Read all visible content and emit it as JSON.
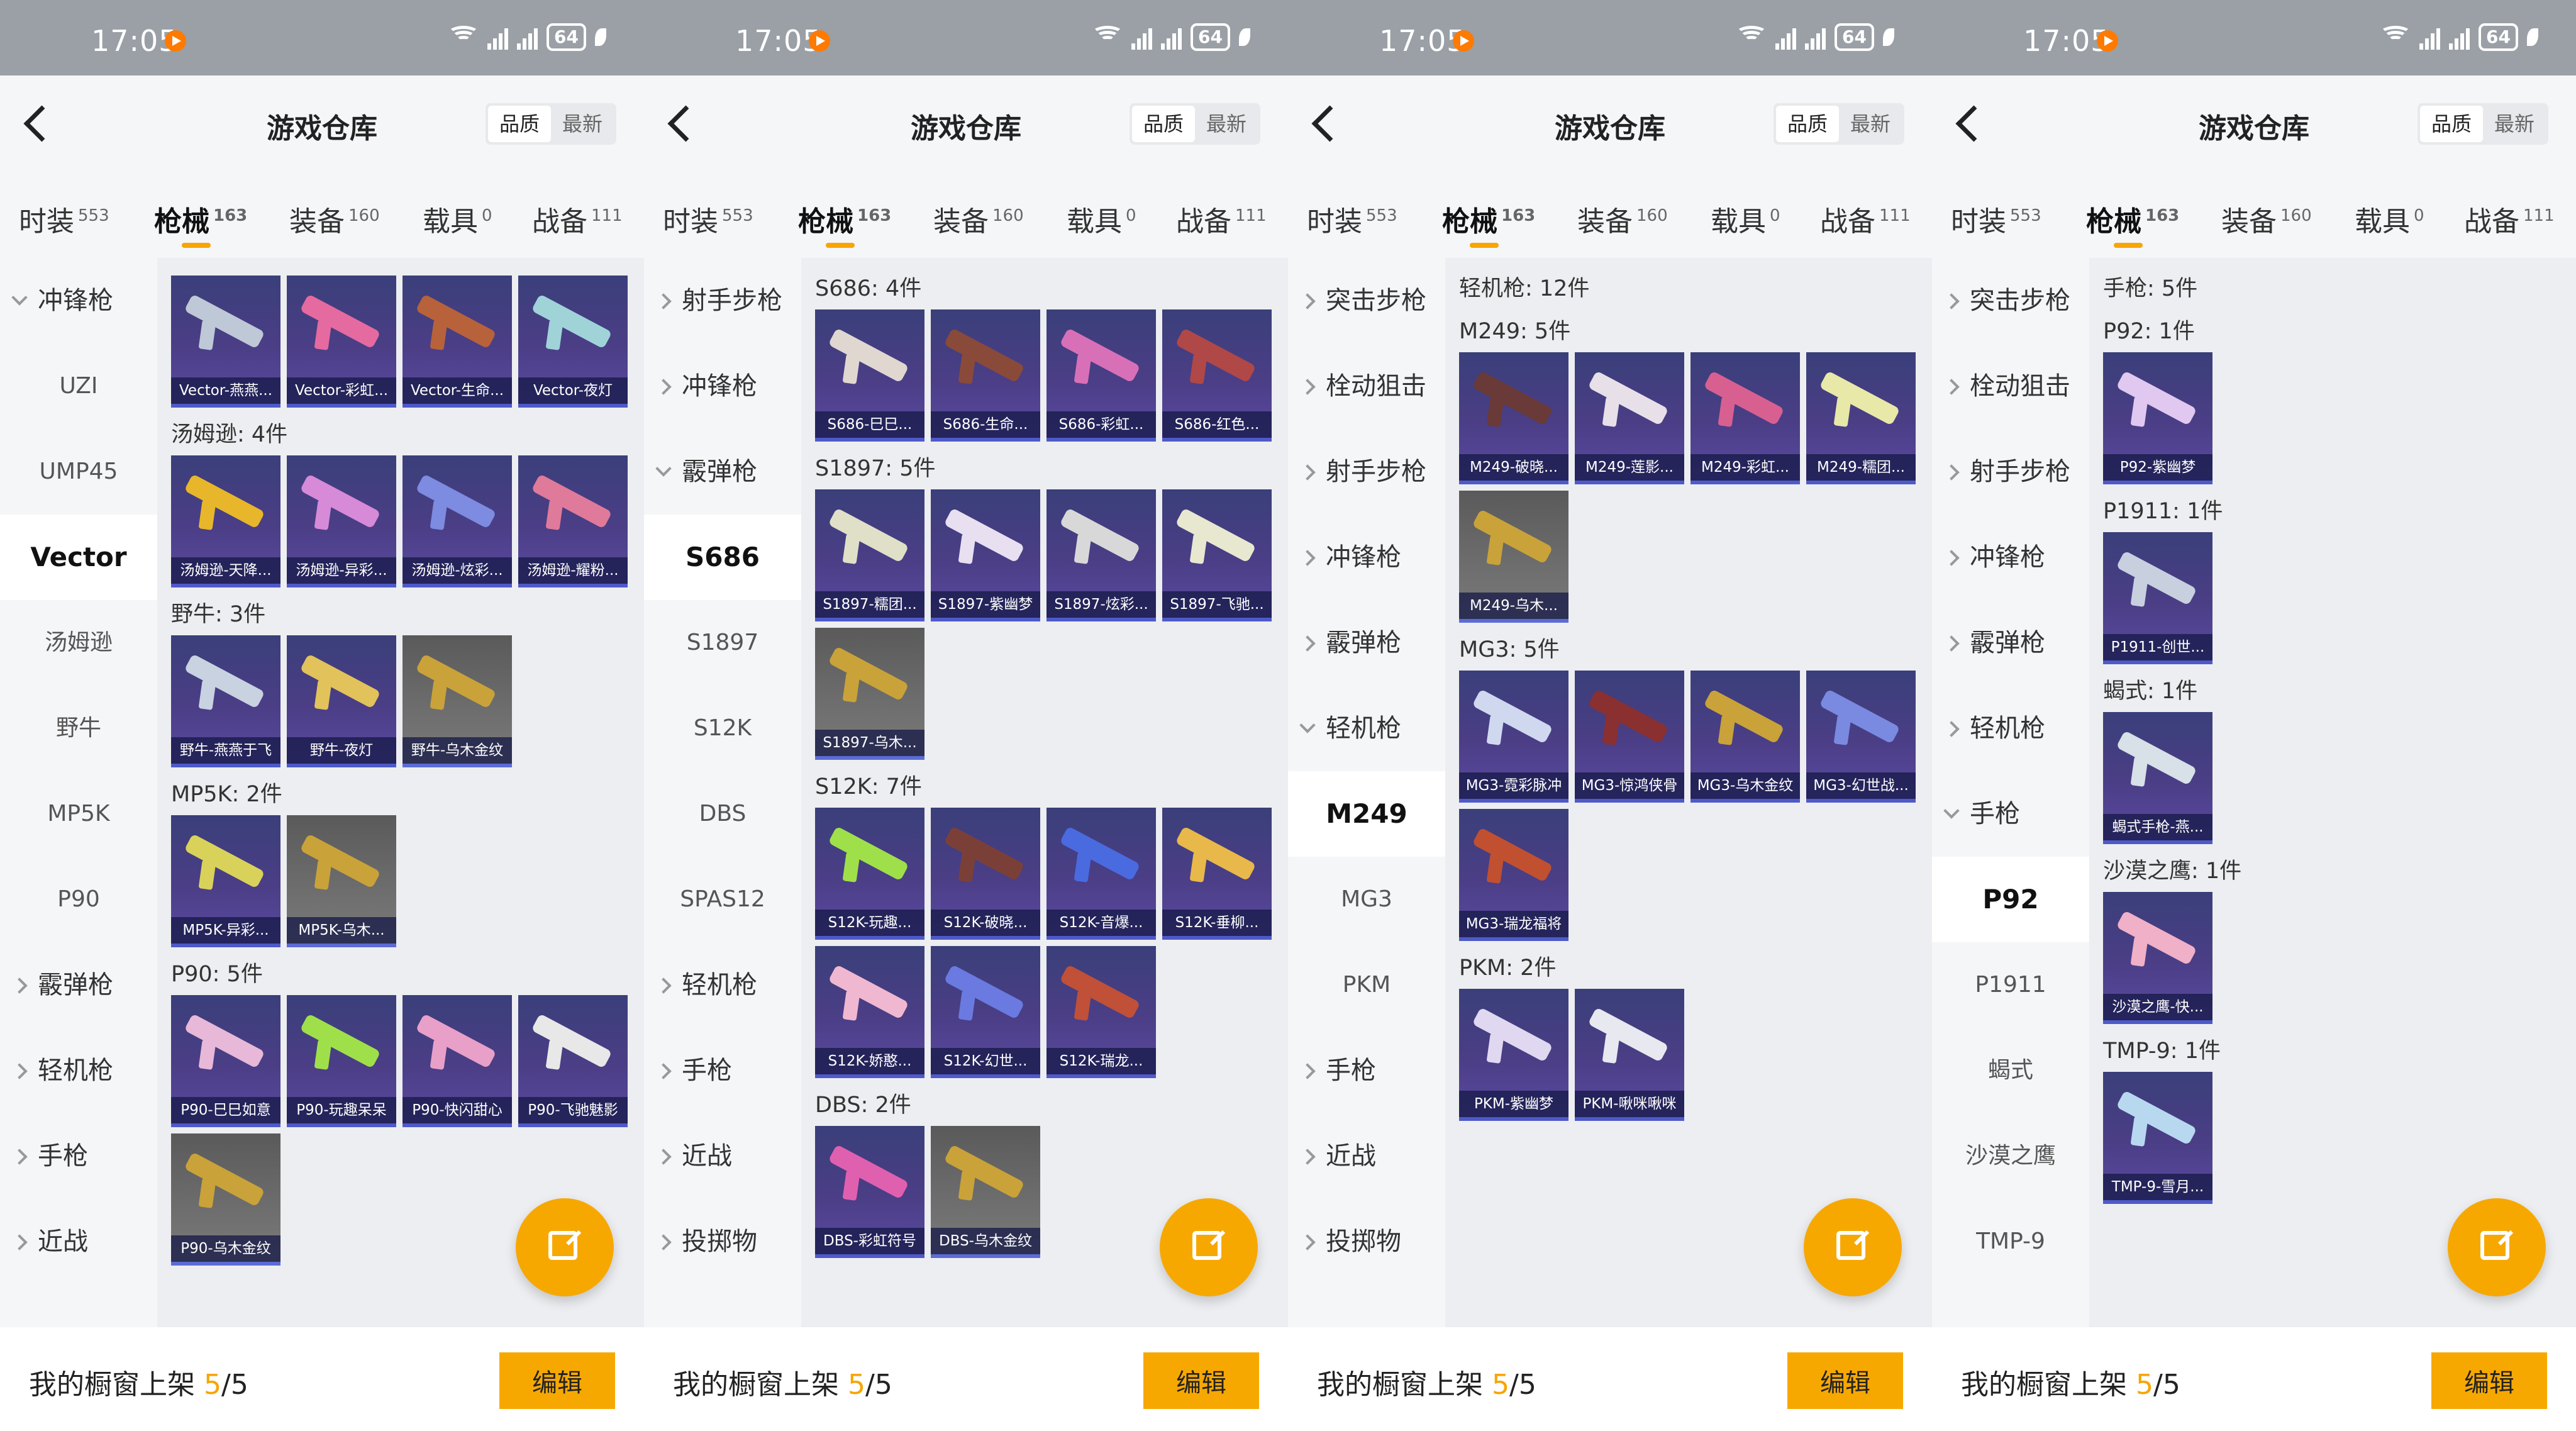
{
  "status_bar": {
    "time": "17:05",
    "battery": "64"
  },
  "header": {
    "title": "游戏仓库",
    "sort_quality": "品质",
    "sort_latest": "最新"
  },
  "tabs": [
    {
      "label": "时装",
      "count": "553"
    },
    {
      "label": "枪械",
      "count": "163"
    },
    {
      "label": "装备",
      "count": "160"
    },
    {
      "label": "载具",
      "count": "0"
    },
    {
      "label": "战备",
      "count": "111"
    }
  ],
  "bottom": {
    "label": "我的橱窗上架",
    "count": "5",
    "total": "/5",
    "edit_label": "编辑"
  },
  "colors": {
    "accent": "#f7a800",
    "card_bg": "#4b3e86"
  },
  "panels": [
    {
      "sidebar": [
        {
          "label": "冲锋枪",
          "type": "cat",
          "open": true
        },
        {
          "label": "UZI",
          "type": "sub"
        },
        {
          "label": "UMP45",
          "type": "sub"
        },
        {
          "label": "Vector",
          "type": "sub",
          "selected": true
        },
        {
          "label": "汤姆逊",
          "type": "sub"
        },
        {
          "label": "野牛",
          "type": "sub"
        },
        {
          "label": "MP5K",
          "type": "sub"
        },
        {
          "label": "P90",
          "type": "sub"
        },
        {
          "label": "霰弹枪",
          "type": "cat"
        },
        {
          "label": "轻机枪",
          "type": "cat"
        },
        {
          "label": "手枪",
          "type": "cat"
        },
        {
          "label": "近战",
          "type": "cat"
        }
      ],
      "groups": [
        {
          "title": "",
          "items": [
            {
              "label": "Vector-燕燕...",
              "color": "#bfc8d6"
            },
            {
              "label": "Vector-彩虹...",
              "color": "#e46aa0"
            },
            {
              "label": "Vector-生命...",
              "color": "#b7623a"
            },
            {
              "label": "Vector-夜灯",
              "color": "#9fd3d8"
            }
          ]
        },
        {
          "title": "汤姆逊: 4件",
          "items": [
            {
              "label": "汤姆逊-天降...",
              "color": "#e8b62a"
            },
            {
              "label": "汤姆逊-异彩...",
              "color": "#d68ad8"
            },
            {
              "label": "汤姆逊-炫彩...",
              "color": "#7d8be0"
            },
            {
              "label": "汤姆逊-耀粉...",
              "color": "#e07a9a"
            }
          ]
        },
        {
          "title": "野牛: 3件",
          "items": [
            {
              "label": "野牛-燕燕于飞",
              "color": "#c9d2e0"
            },
            {
              "label": "野牛-夜灯",
              "color": "#e2c25a"
            },
            {
              "label": "野牛-乌木金纹",
              "color": "#c9a23a",
              "gray": true
            }
          ]
        },
        {
          "title": "MP5K: 2件",
          "items": [
            {
              "label": "MP5K-异彩...",
              "color": "#d9d25a"
            },
            {
              "label": "MP5K-乌木...",
              "color": "#c9a23a",
              "gray": true
            }
          ]
        },
        {
          "title": "P90: 5件",
          "items": [
            {
              "label": "P90-巳巳如意",
              "color": "#e7b8d8"
            },
            {
              "label": "P90-玩趣呆呆",
              "color": "#9fe04a"
            },
            {
              "label": "P90-快闪甜心",
              "color": "#e8a0c8"
            },
            {
              "label": "P90-飞驰魅影",
              "color": "#e8e8e8"
            },
            {
              "label": "P90-乌木金纹",
              "color": "#c9a23a",
              "gray": true
            }
          ]
        }
      ]
    },
    {
      "sidebar": [
        {
          "label": "射手步枪",
          "type": "cat"
        },
        {
          "label": "冲锋枪",
          "type": "cat"
        },
        {
          "label": "霰弹枪",
          "type": "cat",
          "open": true
        },
        {
          "label": "S686",
          "type": "sub",
          "selected": true
        },
        {
          "label": "S1897",
          "type": "sub"
        },
        {
          "label": "S12K",
          "type": "sub"
        },
        {
          "label": "DBS",
          "type": "sub"
        },
        {
          "label": "SPAS12",
          "type": "sub"
        },
        {
          "label": "轻机枪",
          "type": "cat"
        },
        {
          "label": "手枪",
          "type": "cat"
        },
        {
          "label": "近战",
          "type": "cat"
        },
        {
          "label": "投掷物",
          "type": "cat"
        }
      ],
      "groups": [
        {
          "title": "S686: 4件",
          "items": [
            {
              "label": "S686-巳巳...",
              "color": "#e0d8d0"
            },
            {
              "label": "S686-生命...",
              "color": "#8a4a3a"
            },
            {
              "label": "S686-彩虹...",
              "color": "#d870b8"
            },
            {
              "label": "S686-红色...",
              "color": "#b04848"
            }
          ]
        },
        {
          "title": "S1897: 5件",
          "items": [
            {
              "label": "S1897-糯团...",
              "color": "#e0e0c8"
            },
            {
              "label": "S1897-紫幽梦",
              "color": "#e8e0f0"
            },
            {
              "label": "S1897-炫彩...",
              "color": "#d8d8d8"
            },
            {
              "label": "S1897-飞驰...",
              "color": "#e8e8d0"
            },
            {
              "label": "S1897-乌木...",
              "color": "#c9a23a",
              "gray": true
            }
          ]
        },
        {
          "title": "S12K: 7件",
          "items": [
            {
              "label": "S12K-玩趣...",
              "color": "#9fe04a"
            },
            {
              "label": "S12K-破晓...",
              "color": "#7a4038"
            },
            {
              "label": "S12K-音爆...",
              "color": "#4a6ae0"
            },
            {
              "label": "S12K-垂柳...",
              "color": "#e8b84a"
            },
            {
              "label": "S12K-娇憨...",
              "color": "#f0b8d0"
            },
            {
              "label": "S12K-幻世...",
              "color": "#6a7ae0"
            },
            {
              "label": "S12K-瑞龙...",
              "color": "#c05038"
            }
          ]
        },
        {
          "title": "DBS: 2件",
          "items": [
            {
              "label": "DBS-彩虹符号",
              "color": "#e060b0"
            },
            {
              "label": "DBS-乌木金纹",
              "color": "#c9a23a",
              "gray": true
            }
          ]
        }
      ]
    },
    {
      "sidebar": [
        {
          "label": "突击步枪",
          "type": "cat"
        },
        {
          "label": "栓动狙击",
          "type": "cat"
        },
        {
          "label": "射手步枪",
          "type": "cat"
        },
        {
          "label": "冲锋枪",
          "type": "cat"
        },
        {
          "label": "霰弹枪",
          "type": "cat"
        },
        {
          "label": "轻机枪",
          "type": "cat",
          "open": true
        },
        {
          "label": "M249",
          "type": "sub",
          "selected": true
        },
        {
          "label": "MG3",
          "type": "sub"
        },
        {
          "label": "PKM",
          "type": "sub"
        },
        {
          "label": "手枪",
          "type": "cat"
        },
        {
          "label": "近战",
          "type": "cat"
        },
        {
          "label": "投掷物",
          "type": "cat"
        }
      ],
      "groups": [
        {
          "title": "轻机枪: 12件",
          "items": []
        },
        {
          "title": "M249: 5件",
          "items": [
            {
              "label": "M249-破晓...",
              "color": "#6a3a38"
            },
            {
              "label": "M249-莲影...",
              "color": "#e8e0e8"
            },
            {
              "label": "M249-彩虹...",
              "color": "#d86090"
            },
            {
              "label": "M249-糯团...",
              "color": "#e8e8a8"
            },
            {
              "label": "M249-乌木...",
              "color": "#c9a23a",
              "gray": true
            }
          ]
        },
        {
          "title": "MG3: 5件",
          "items": [
            {
              "label": "MG3-霓彩脉冲",
              "color": "#d0d8f0"
            },
            {
              "label": "MG3-惊鸿侠骨",
              "color": "#8a3030"
            },
            {
              "label": "MG3-乌木金纹",
              "color": "#c9a23a"
            },
            {
              "label": "MG3-幻世战...",
              "color": "#7a8ae0"
            },
            {
              "label": "MG3-瑞龙福将",
              "color": "#c05030"
            }
          ]
        },
        {
          "title": "PKM: 2件",
          "items": [
            {
              "label": "PKM-紫幽梦",
              "color": "#e0d8f0"
            },
            {
              "label": "PKM-啾咪啾咪",
              "color": "#e8e8f0"
            }
          ]
        }
      ]
    },
    {
      "sidebar": [
        {
          "label": "突击步枪",
          "type": "cat"
        },
        {
          "label": "栓动狙击",
          "type": "cat"
        },
        {
          "label": "射手步枪",
          "type": "cat"
        },
        {
          "label": "冲锋枪",
          "type": "cat"
        },
        {
          "label": "霰弹枪",
          "type": "cat"
        },
        {
          "label": "轻机枪",
          "type": "cat"
        },
        {
          "label": "手枪",
          "type": "cat",
          "open": true
        },
        {
          "label": "P92",
          "type": "sub",
          "selected": true
        },
        {
          "label": "P1911",
          "type": "sub"
        },
        {
          "label": "蝎式",
          "type": "sub"
        },
        {
          "label": "沙漠之鹰",
          "type": "sub"
        },
        {
          "label": "TMP-9",
          "type": "sub"
        }
      ],
      "groups": [
        {
          "title": "手枪: 5件",
          "items": []
        },
        {
          "title": "P92: 1件",
          "items": [
            {
              "label": "P92-紫幽梦",
              "color": "#e0c8f0"
            }
          ]
        },
        {
          "title": "P1911: 1件",
          "items": [
            {
              "label": "P1911-创世...",
              "color": "#c8d0e0"
            }
          ]
        },
        {
          "title": "蝎式: 1件",
          "items": [
            {
              "label": "蝎式手枪-燕...",
              "color": "#d8e0e8"
            }
          ]
        },
        {
          "title": "沙漠之鹰: 1件",
          "items": [
            {
              "label": "沙漠之鹰-快...",
              "color": "#f0b0c8"
            }
          ]
        },
        {
          "title": "TMP-9: 1件",
          "items": [
            {
              "label": "TMP-9-雪月...",
              "color": "#b8d8f0"
            }
          ]
        }
      ]
    }
  ]
}
